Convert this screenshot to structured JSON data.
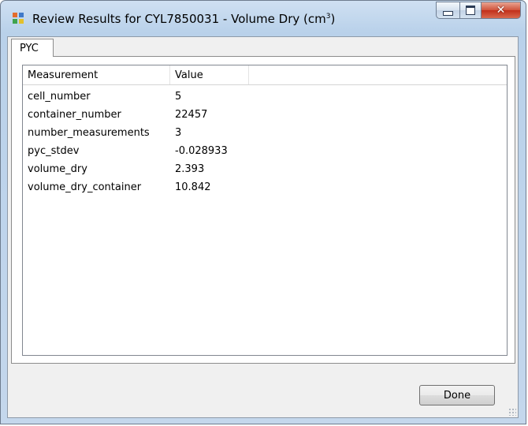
{
  "window": {
    "title_prefix": "Review Results for CYL7850031 - Volume Dry (cm",
    "title_superscript": "3",
    "title_suffix": ")"
  },
  "tabs": [
    {
      "label": "PYC",
      "selected": true
    }
  ],
  "listview": {
    "columns": [
      {
        "label": "Measurement"
      },
      {
        "label": "Value"
      },
      {
        "label": ""
      }
    ],
    "rows": [
      {
        "measurement": "cell_number",
        "value": "5"
      },
      {
        "measurement": "container_number",
        "value": "22457"
      },
      {
        "measurement": "number_measurements",
        "value": "3"
      },
      {
        "measurement": "pyc_stdev",
        "value": "-0.028933"
      },
      {
        "measurement": "volume_dry",
        "value": "2.393"
      },
      {
        "measurement": "volume_dry_container",
        "value": "10.842"
      }
    ]
  },
  "buttons": {
    "done_label": "Done"
  },
  "caption_buttons": [
    "minimize-icon",
    "maximize-icon",
    "close-icon"
  ],
  "colors": {
    "titlebar": "#b9d1ea",
    "close_button": "#c94a32",
    "client_background": "#f0f0f0"
  }
}
